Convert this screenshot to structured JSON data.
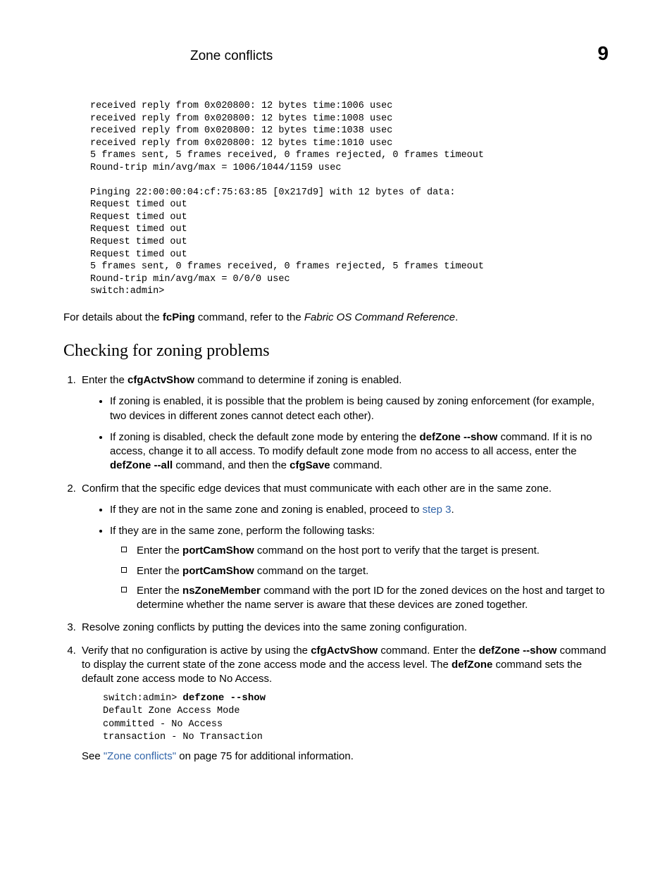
{
  "header": {
    "title": "Zone conflicts",
    "chapter": "9"
  },
  "code1": "received reply from 0x020800: 12 bytes time:1006 usec\nreceived reply from 0x020800: 12 bytes time:1008 usec\nreceived reply from 0x020800: 12 bytes time:1038 usec\nreceived reply from 0x020800: 12 bytes time:1010 usec\n5 frames sent, 5 frames received, 0 frames rejected, 0 frames timeout\nRound-trip min/avg/max = 1006/1044/1159 usec\n\nPinging 22:00:00:04:cf:75:63:85 [0x217d9] with 12 bytes of data:\nRequest timed out\nRequest timed out\nRequest timed out\nRequest timed out\nRequest timed out\n5 frames sent, 0 frames received, 0 frames rejected, 5 frames timeout\nRound-trip min/avg/max = 0/0/0 usec\nswitch:admin>",
  "p1": {
    "a": "For details about the ",
    "b": "fcPing",
    "c": " command, refer to the ",
    "d": "Fabric OS Command Reference",
    "e": "."
  },
  "h2": "Checking for zoning problems",
  "steps": {
    "s1": {
      "a": "Enter the ",
      "b": "cfgActvShow",
      "c": " command to determine if zoning is enabled.",
      "bul1": "If zoning is enabled, it is possible that the problem is being caused by zoning enforcement (for example, two devices in different zones cannot detect each other).",
      "bul2": {
        "a": "If zoning is disabled, check the default zone mode by entering the ",
        "b": "defZone --show",
        "c": " command. If it is no access, change it to all access. To modify default zone mode from no access to all access, enter the ",
        "d": "defZone --all",
        "e": " command, and then the ",
        "f": "cfgSave",
        "g": " command."
      }
    },
    "s2": {
      "a": "Confirm that the specific edge devices that must communicate with each other are in the same zone.",
      "bul1": {
        "a": "If they are not in the same zone and zoning is enabled, proceed to ",
        "b": "step 3",
        "c": "."
      },
      "bul2": "If they are in the same zone, perform the following tasks:",
      "sq1": {
        "a": "Enter the ",
        "b": "portCamShow",
        "c": " command on the host port to verify that the target is present."
      },
      "sq2": {
        "a": "Enter the ",
        "b": "portCamShow",
        "c": " command on the target."
      },
      "sq3": {
        "a": "Enter the ",
        "b": "nsZoneMember",
        "c": " command with the port ID for the zoned devices on the host and target to determine whether the name server is aware that these devices are zoned together."
      }
    },
    "s3": "Resolve zoning conflicts by putting the devices into the same zoning configuration.",
    "s4": {
      "a": "Verify that no configuration is active by using the ",
      "b": "cfgActvShow",
      "c": " command. Enter the ",
      "d": "defZone --show",
      "e": " command to display the current state of the zone access mode and the access level. The ",
      "f": "defZone",
      "g": " command sets the default zone access mode to No Access."
    }
  },
  "code2": {
    "prompt": "switch:admin> ",
    "cmd": "defzone --show",
    "rest": "Default Zone Access Mode\ncommitted - No Access\ntransaction - No Transaction"
  },
  "closing": {
    "a": "See ",
    "b": "\"Zone conflicts\"",
    "c": " on page 75 for additional information."
  }
}
